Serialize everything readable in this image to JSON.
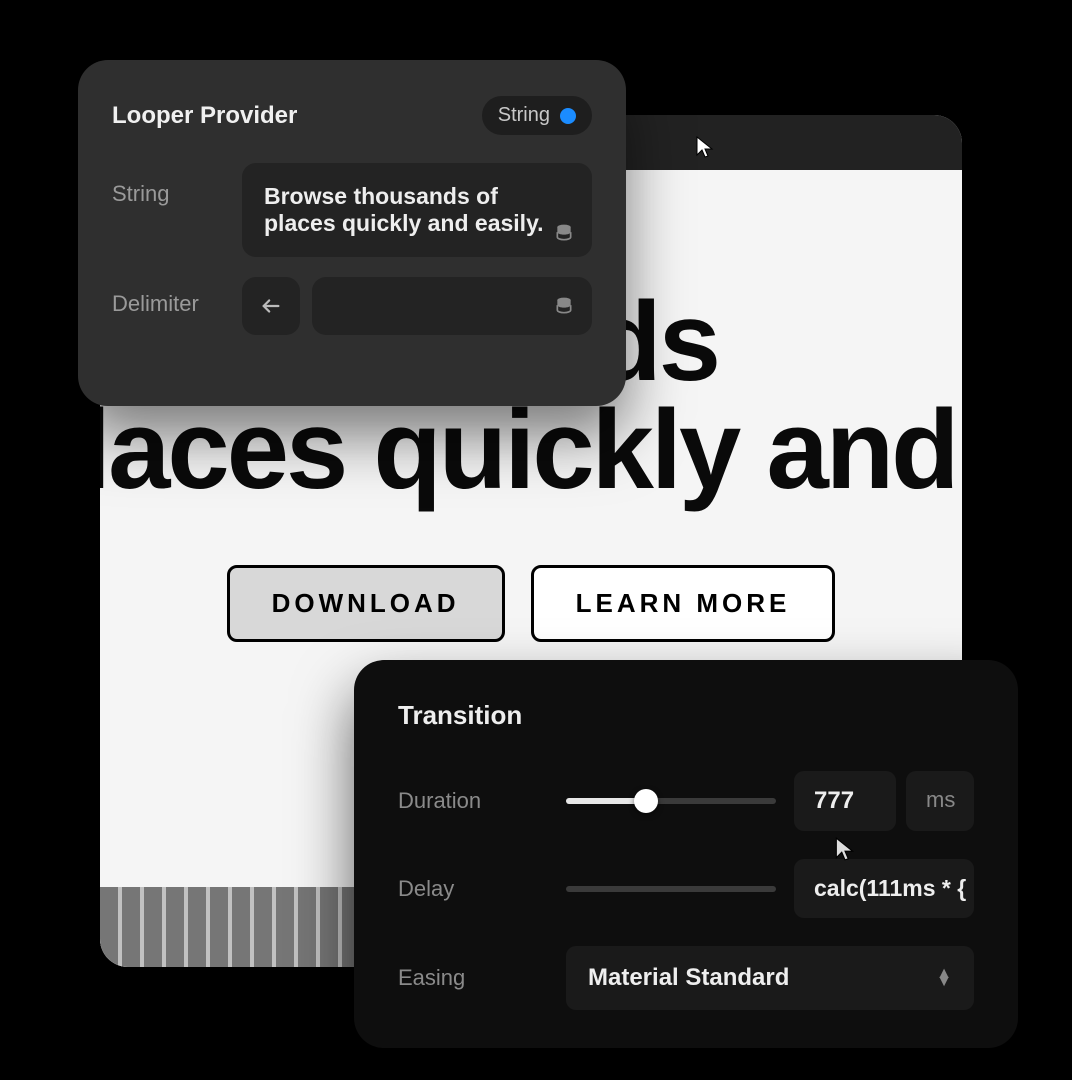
{
  "looper": {
    "title": "Looper Provider",
    "type_chip": "String",
    "string_label": "String",
    "string_value": "Browse thousands of places quickly and easily.",
    "delimiter_label": "Delimiter",
    "delimiter_value": ""
  },
  "canvas": {
    "hero_line1": "usands",
    "hero_line2": "laces quickly and ea",
    "download_label": "DOWNLOAD",
    "learn_more_label": "LEARN MORE"
  },
  "transition": {
    "title": "Transition",
    "duration_label": "Duration",
    "duration_value": "777",
    "duration_unit": "ms",
    "duration_slider_percent": 38,
    "delay_label": "Delay",
    "delay_value": "calc(111ms * {",
    "delay_slider_percent": 0,
    "easing_label": "Easing",
    "easing_value": "Material Standard"
  },
  "colors": {
    "accent": "#1b8cff"
  }
}
